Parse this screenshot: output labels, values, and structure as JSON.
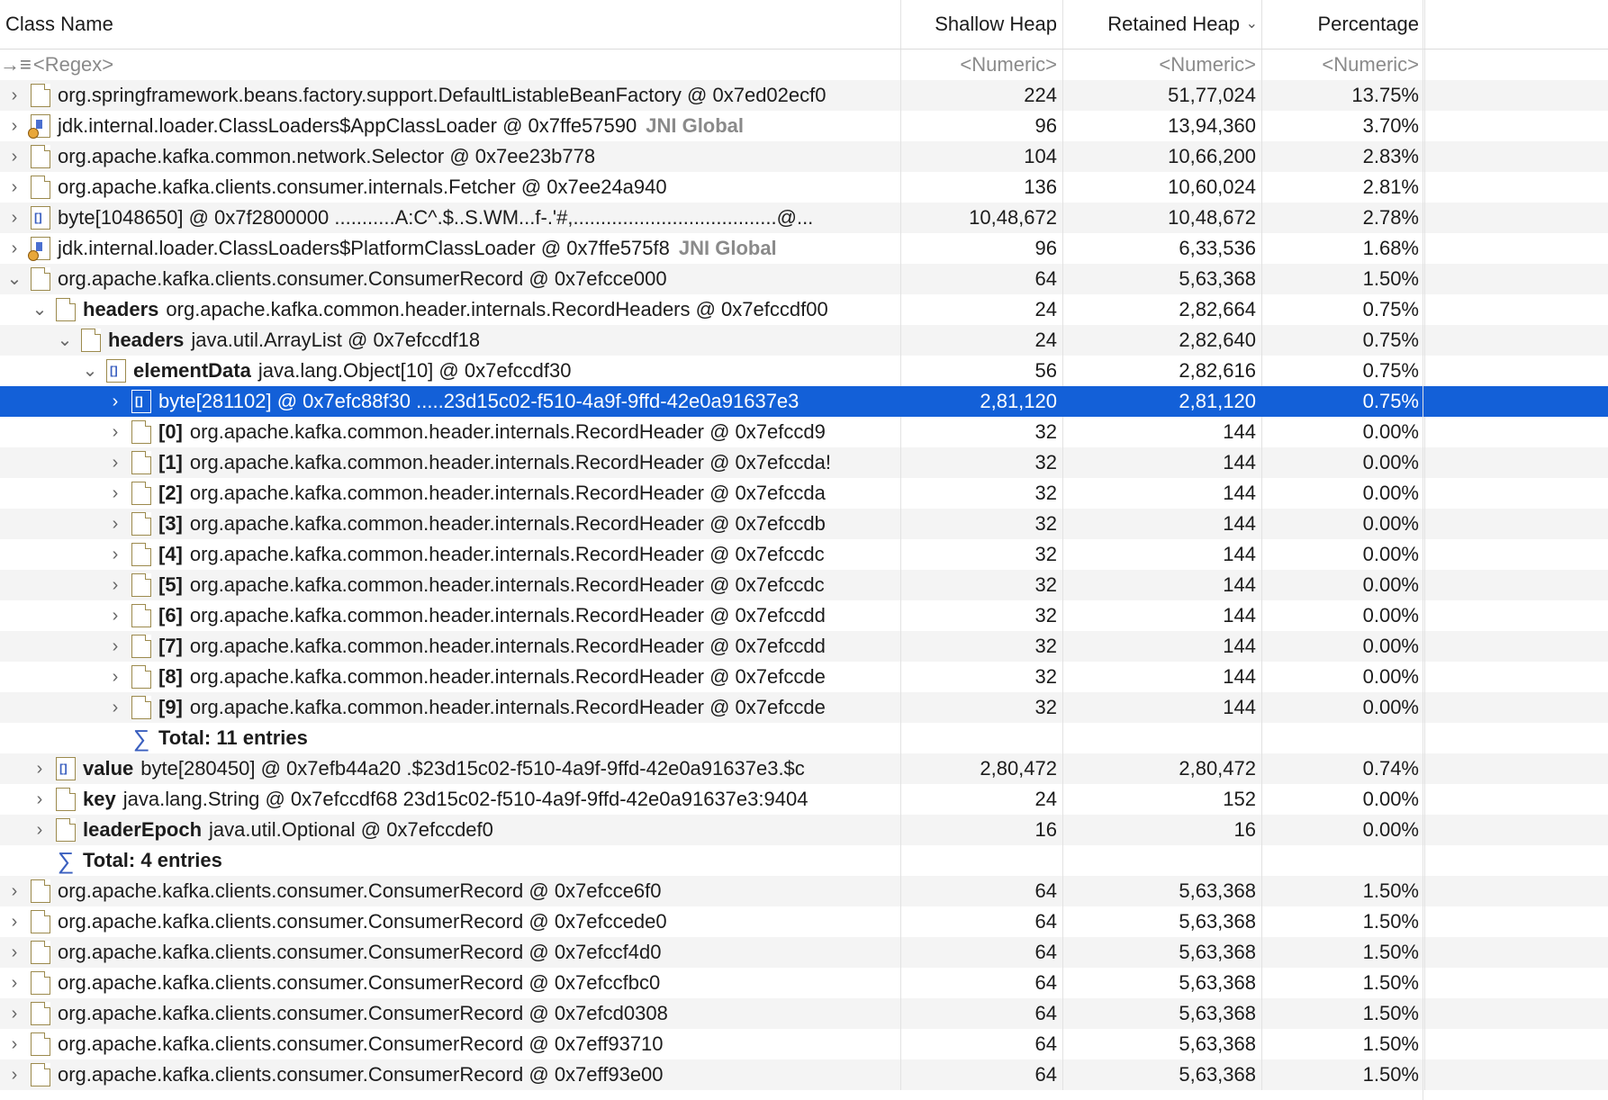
{
  "columns": {
    "class_name": "Class Name",
    "shallow_heap": "Shallow Heap",
    "retained_heap": "Retained Heap",
    "percentage": "Percentage"
  },
  "filter_row": {
    "regex": "<Regex>",
    "numeric": "<Numeric>"
  },
  "rows": [
    {
      "indent": 0,
      "twisty": ">",
      "icon": "obj",
      "field": "",
      "text": "org.springframework.beans.factory.support.DefaultListableBeanFactory @ 0x7ed02ecf0",
      "tag": "",
      "shallow": "224",
      "retained": "51,77,024",
      "pct": "13.75%"
    },
    {
      "indent": 0,
      "twisty": ">",
      "icon": "cl",
      "field": "",
      "text": "jdk.internal.loader.ClassLoaders$AppClassLoader @ 0x7ffe57590",
      "tag": "JNI Global",
      "shallow": "96",
      "retained": "13,94,360",
      "pct": "3.70%"
    },
    {
      "indent": 0,
      "twisty": ">",
      "icon": "obj",
      "field": "",
      "text": "org.apache.kafka.common.network.Selector @ 0x7ee23b778",
      "tag": "",
      "shallow": "104",
      "retained": "10,66,200",
      "pct": "2.83%"
    },
    {
      "indent": 0,
      "twisty": ">",
      "icon": "obj",
      "field": "",
      "text": "org.apache.kafka.clients.consumer.internals.Fetcher @ 0x7ee24a940",
      "tag": "",
      "shallow": "136",
      "retained": "10,60,024",
      "pct": "2.81%"
    },
    {
      "indent": 0,
      "twisty": ">",
      "icon": "arr",
      "field": "",
      "text": "byte[1048650] @ 0x7f2800000  ...........A:C^.$..S.WM...f-.'#,.....................................@...",
      "tag": "",
      "shallow": "10,48,672",
      "retained": "10,48,672",
      "pct": "2.78%"
    },
    {
      "indent": 0,
      "twisty": ">",
      "icon": "cl",
      "field": "",
      "text": "jdk.internal.loader.ClassLoaders$PlatformClassLoader @ 0x7ffe575f8",
      "tag": "JNI Global",
      "shallow": "96",
      "retained": "6,33,536",
      "pct": "1.68%"
    },
    {
      "indent": 0,
      "twisty": "v",
      "icon": "obj",
      "field": "",
      "text": "org.apache.kafka.clients.consumer.ConsumerRecord @ 0x7efcce000",
      "tag": "",
      "shallow": "64",
      "retained": "5,63,368",
      "pct": "1.50%"
    },
    {
      "indent": 1,
      "twisty": "v",
      "icon": "obj",
      "field": "headers",
      "text": "org.apache.kafka.common.header.internals.RecordHeaders @ 0x7efccdf00",
      "tag": "",
      "shallow": "24",
      "retained": "2,82,664",
      "pct": "0.75%"
    },
    {
      "indent": 2,
      "twisty": "v",
      "icon": "obj",
      "field": "headers",
      "text": "java.util.ArrayList @ 0x7efccdf18",
      "tag": "",
      "shallow": "24",
      "retained": "2,82,640",
      "pct": "0.75%"
    },
    {
      "indent": 3,
      "twisty": "v",
      "icon": "arr",
      "field": "elementData",
      "text": "java.lang.Object[10] @ 0x7efccdf30",
      "tag": "",
      "shallow": "56",
      "retained": "2,82,616",
      "pct": "0.75%"
    },
    {
      "indent": 4,
      "twisty": ">",
      "icon": "arr",
      "field": "",
      "text": "byte[281102] @ 0x7efc88f30  .....23d15c02-f510-4a9f-9ffd-42e0a91637e3",
      "tag": "",
      "shallow": "2,81,120",
      "retained": "2,81,120",
      "pct": "0.75%",
      "selected": true
    },
    {
      "indent": 4,
      "twisty": ">",
      "icon": "obj",
      "field": "[0]",
      "text": "org.apache.kafka.common.header.internals.RecordHeader @ 0x7efccd9",
      "tag": "",
      "shallow": "32",
      "retained": "144",
      "pct": "0.00%"
    },
    {
      "indent": 4,
      "twisty": ">",
      "icon": "obj",
      "field": "[1]",
      "text": "org.apache.kafka.common.header.internals.RecordHeader @ 0x7efccda!",
      "tag": "",
      "shallow": "32",
      "retained": "144",
      "pct": "0.00%"
    },
    {
      "indent": 4,
      "twisty": ">",
      "icon": "obj",
      "field": "[2]",
      "text": "org.apache.kafka.common.header.internals.RecordHeader @ 0x7efccda",
      "tag": "",
      "shallow": "32",
      "retained": "144",
      "pct": "0.00%"
    },
    {
      "indent": 4,
      "twisty": ">",
      "icon": "obj",
      "field": "[3]",
      "text": "org.apache.kafka.common.header.internals.RecordHeader @ 0x7efccdb",
      "tag": "",
      "shallow": "32",
      "retained": "144",
      "pct": "0.00%"
    },
    {
      "indent": 4,
      "twisty": ">",
      "icon": "obj",
      "field": "[4]",
      "text": "org.apache.kafka.common.header.internals.RecordHeader @ 0x7efccdc",
      "tag": "",
      "shallow": "32",
      "retained": "144",
      "pct": "0.00%"
    },
    {
      "indent": 4,
      "twisty": ">",
      "icon": "obj",
      "field": "[5]",
      "text": "org.apache.kafka.common.header.internals.RecordHeader @ 0x7efccdc",
      "tag": "",
      "shallow": "32",
      "retained": "144",
      "pct": "0.00%"
    },
    {
      "indent": 4,
      "twisty": ">",
      "icon": "obj",
      "field": "[6]",
      "text": "org.apache.kafka.common.header.internals.RecordHeader @ 0x7efccdd",
      "tag": "",
      "shallow": "32",
      "retained": "144",
      "pct": "0.00%"
    },
    {
      "indent": 4,
      "twisty": ">",
      "icon": "obj",
      "field": "[7]",
      "text": "org.apache.kafka.common.header.internals.RecordHeader @ 0x7efccdd",
      "tag": "",
      "shallow": "32",
      "retained": "144",
      "pct": "0.00%"
    },
    {
      "indent": 4,
      "twisty": ">",
      "icon": "obj",
      "field": "[8]",
      "text": "org.apache.kafka.common.header.internals.RecordHeader @ 0x7efccde",
      "tag": "",
      "shallow": "32",
      "retained": "144",
      "pct": "0.00%"
    },
    {
      "indent": 4,
      "twisty": ">",
      "icon": "obj",
      "field": "[9]",
      "text": "org.apache.kafka.common.header.internals.RecordHeader @ 0x7efccde",
      "tag": "",
      "shallow": "32",
      "retained": "144",
      "pct": "0.00%"
    },
    {
      "indent": 4,
      "twisty": "",
      "icon": "sigma",
      "field": "",
      "text": "Total: 11 entries",
      "tag": "",
      "shallow": "",
      "retained": "",
      "pct": "",
      "total": true
    },
    {
      "indent": 1,
      "twisty": ">",
      "icon": "arr",
      "field": "value",
      "text": "byte[280450] @ 0x7efb44a20  .$23d15c02-f510-4a9f-9ffd-42e0a91637e3.$c",
      "tag": "",
      "shallow": "2,80,472",
      "retained": "2,80,472",
      "pct": "0.74%"
    },
    {
      "indent": 1,
      "twisty": ">",
      "icon": "obj",
      "field": "key",
      "text": "java.lang.String @ 0x7efccdf68  23d15c02-f510-4a9f-9ffd-42e0a91637e3:9404",
      "tag": "",
      "shallow": "24",
      "retained": "152",
      "pct": "0.00%"
    },
    {
      "indent": 1,
      "twisty": ">",
      "icon": "obj",
      "field": "leaderEpoch",
      "text": "java.util.Optional @ 0x7efccdef0",
      "tag": "",
      "shallow": "16",
      "retained": "16",
      "pct": "0.00%"
    },
    {
      "indent": 1,
      "twisty": "",
      "icon": "sigma",
      "field": "",
      "text": "Total: 4 entries",
      "tag": "",
      "shallow": "",
      "retained": "",
      "pct": "",
      "total": true
    },
    {
      "indent": 0,
      "twisty": ">",
      "icon": "obj",
      "field": "",
      "text": "org.apache.kafka.clients.consumer.ConsumerRecord @ 0x7efcce6f0",
      "tag": "",
      "shallow": "64",
      "retained": "5,63,368",
      "pct": "1.50%"
    },
    {
      "indent": 0,
      "twisty": ">",
      "icon": "obj",
      "field": "",
      "text": "org.apache.kafka.clients.consumer.ConsumerRecord @ 0x7efccede0",
      "tag": "",
      "shallow": "64",
      "retained": "5,63,368",
      "pct": "1.50%"
    },
    {
      "indent": 0,
      "twisty": ">",
      "icon": "obj",
      "field": "",
      "text": "org.apache.kafka.clients.consumer.ConsumerRecord @ 0x7efccf4d0",
      "tag": "",
      "shallow": "64",
      "retained": "5,63,368",
      "pct": "1.50%"
    },
    {
      "indent": 0,
      "twisty": ">",
      "icon": "obj",
      "field": "",
      "text": "org.apache.kafka.clients.consumer.ConsumerRecord @ 0x7efccfbc0",
      "tag": "",
      "shallow": "64",
      "retained": "5,63,368",
      "pct": "1.50%"
    },
    {
      "indent": 0,
      "twisty": ">",
      "icon": "obj",
      "field": "",
      "text": "org.apache.kafka.clients.consumer.ConsumerRecord @ 0x7efcd0308",
      "tag": "",
      "shallow": "64",
      "retained": "5,63,368",
      "pct": "1.50%"
    },
    {
      "indent": 0,
      "twisty": ">",
      "icon": "obj",
      "field": "",
      "text": "org.apache.kafka.clients.consumer.ConsumerRecord @ 0x7eff93710",
      "tag": "",
      "shallow": "64",
      "retained": "5,63,368",
      "pct": "1.50%"
    },
    {
      "indent": 0,
      "twisty": ">",
      "icon": "obj",
      "field": "",
      "text": "org.apache.kafka.clients.consumer.ConsumerRecord @ 0x7eff93e00",
      "tag": "",
      "shallow": "64",
      "retained": "5,63,368",
      "pct": "1.50%"
    }
  ],
  "colors": {
    "selection": "#1360d8",
    "alt_row": "#f4f4f4",
    "jni_tag": "#8a8a8a"
  }
}
